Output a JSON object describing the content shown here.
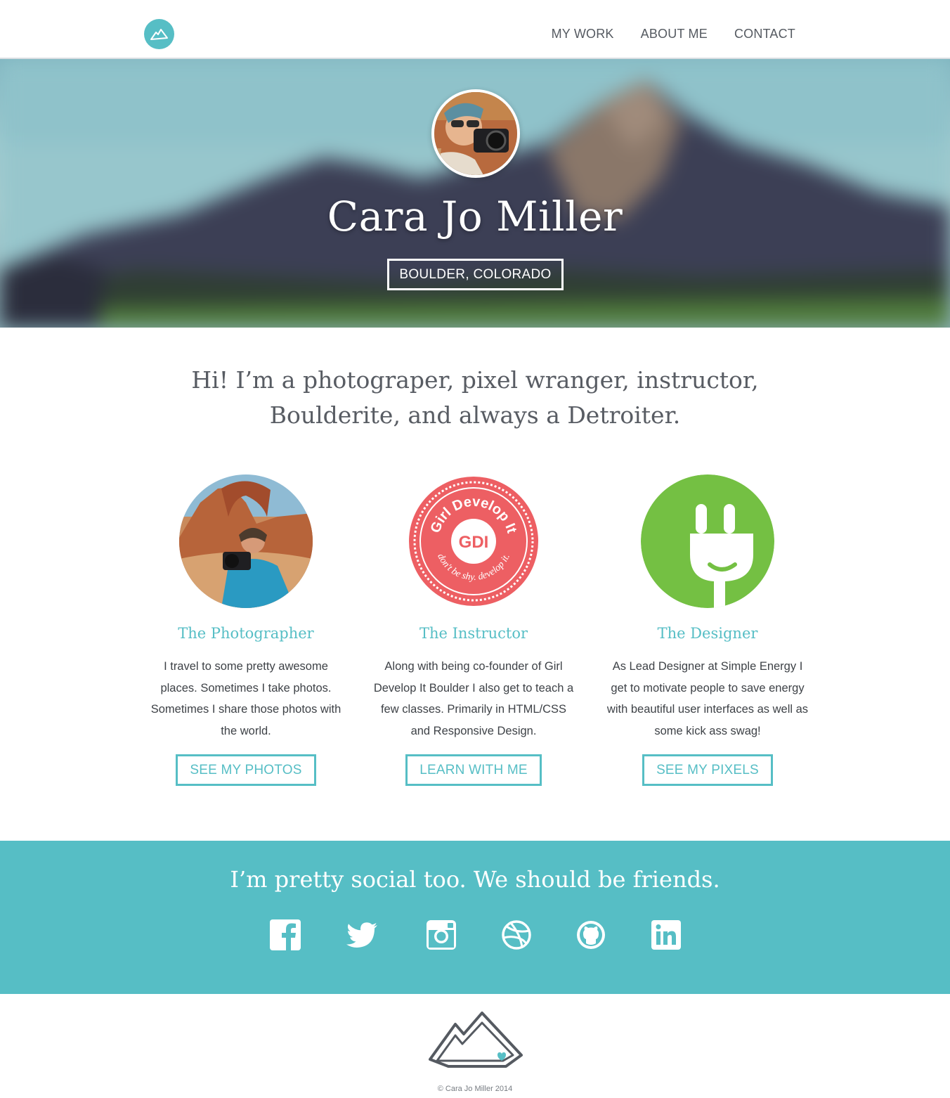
{
  "nav": {
    "links": [
      "MY WORK",
      "ABOUT ME",
      "CONTACT"
    ]
  },
  "hero": {
    "name": "Cara Jo Miller",
    "location": "BOULDER, COLORADO"
  },
  "intro": {
    "line1": "Hi! I’m a photograper,  pixel wranger, instructor,",
    "line2": "Boulderite, and always a Detroiter."
  },
  "columns": [
    {
      "title": "The Photographer",
      "text": "I travel to some pretty awesome places. Sometimes I take photos. Sometimes I share those photos with the world.",
      "button": "SEE MY PHOTOS"
    },
    {
      "title": "The Instructor",
      "text": "Along with being co-founder of Girl Develop It Boulder I also get to teach a few classes. Primarily in HTML/CSS and Responsive Design.",
      "button": "LEARN WITH ME",
      "badge": {
        "top": "Girl Develop It",
        "center": "GDI",
        "bottom": "don't be shy. develop it."
      }
    },
    {
      "title": "The Designer",
      "text": "As Lead Designer at Simple Energy I get to motivate people to save energy with beautiful user interfaces as well as some kick ass swag!",
      "button": "SEE MY PIXELS"
    }
  ],
  "social": {
    "title": "I’m pretty social too. We should be friends.",
    "icons": [
      "facebook-icon",
      "twitter-icon",
      "instagram-icon",
      "dribbble-icon",
      "github-icon",
      "linkedin-icon"
    ]
  },
  "footer": {
    "copyright": "© Cara Jo Miller 2014"
  },
  "colors": {
    "accent": "#56bec5",
    "text": "#555a61",
    "designer_green": "#74c043",
    "gdi_red": "#ed5f63"
  }
}
